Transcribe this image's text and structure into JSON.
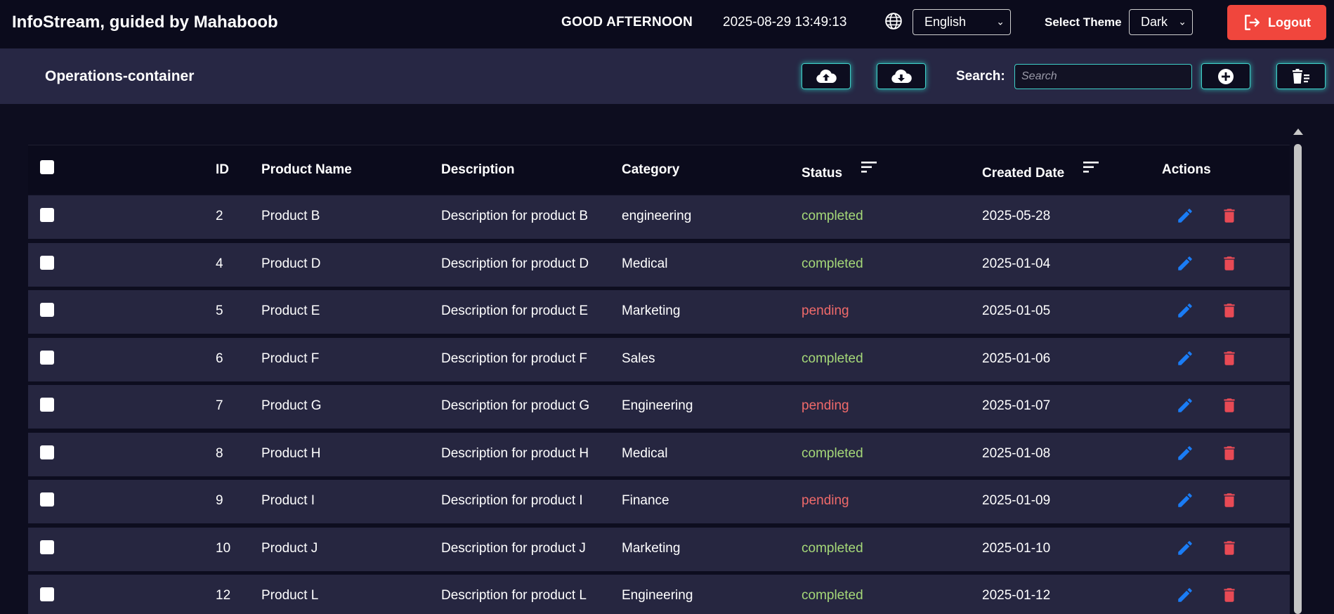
{
  "header": {
    "app_title": "InfoStream, guided by Mahaboob",
    "greeting": "GOOD AFTERNOON",
    "datetime": "2025-08-29 13:49:13",
    "language": "English",
    "theme_label": "Select Theme",
    "theme_value": "Dark",
    "logout_label": "Logout"
  },
  "ops": {
    "title": "Operations-container",
    "search_label": "Search:",
    "search_placeholder": "Search"
  },
  "table": {
    "columns": [
      "ID",
      "Product Name",
      "Description",
      "Category",
      "Status",
      "Created Date",
      "Actions"
    ],
    "rows": [
      {
        "id": "2",
        "name": "Product B",
        "description": "Description for product B",
        "category": "engineering",
        "status": "completed",
        "date": "2025-05-28"
      },
      {
        "id": "4",
        "name": "Product D",
        "description": "Description for product D",
        "category": "Medical",
        "status": "completed",
        "date": "2025-01-04"
      },
      {
        "id": "5",
        "name": "Product E",
        "description": "Description for product E",
        "category": "Marketing",
        "status": "pending",
        "date": "2025-01-05"
      },
      {
        "id": "6",
        "name": "Product F",
        "description": "Description for product F",
        "category": "Sales",
        "status": "completed",
        "date": "2025-01-06"
      },
      {
        "id": "7",
        "name": "Product G",
        "description": "Description for product G",
        "category": "Engineering",
        "status": "pending",
        "date": "2025-01-07"
      },
      {
        "id": "8",
        "name": "Product H",
        "description": "Description for product H",
        "category": "Medical",
        "status": "completed",
        "date": "2025-01-08"
      },
      {
        "id": "9",
        "name": "Product I",
        "description": "Description for product I",
        "category": "Finance",
        "status": "pending",
        "date": "2025-01-09"
      },
      {
        "id": "10",
        "name": "Product J",
        "description": "Description for product J",
        "category": "Marketing",
        "status": "completed",
        "date": "2025-01-10"
      },
      {
        "id": "12",
        "name": "Product L",
        "description": "Description for product L",
        "category": "Engineering",
        "status": "completed",
        "date": "2025-01-12"
      }
    ]
  },
  "colors": {
    "completed": "#a5d878",
    "pending": "#f06a6a",
    "edit_icon": "#1a7cf5",
    "delete_icon": "#e84a55",
    "accent_glow": "#3fd0c8",
    "logout_bg": "#f0463d"
  },
  "icons": {
    "globe": "globe-icon",
    "logout": "logout-icon",
    "upload": "cloud-upload-icon",
    "download": "cloud-download-icon",
    "add": "plus-circle-icon",
    "bulk_delete": "trash-list-icon",
    "sort": "sort-icon",
    "edit": "pencil-icon",
    "delete": "trash-icon"
  }
}
